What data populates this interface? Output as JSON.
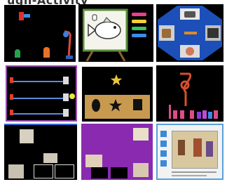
{
  "page": {
    "top_strip_text": "ugh-Activity"
  },
  "tiles": [
    {
      "id": "t1",
      "theme": "black-stage",
      "icons": [
        "toy-red",
        "ball-blue",
        "figure-green",
        "figure-orange",
        "toy-blue-lever"
      ]
    },
    {
      "id": "t2",
      "theme": "easel-board",
      "icons": [
        "fish-on-easel",
        "marker-pink",
        "marker-yellow",
        "marker-green",
        "marker-blue"
      ]
    },
    {
      "id": "t3",
      "theme": "octagon-carousel",
      "icons": [
        "camera",
        "cake",
        "pencil",
        "tool",
        "doll"
      ]
    },
    {
      "id": "t4",
      "theme": "race-lanes",
      "icons": [
        "runner",
        "bunny",
        "ball"
      ]
    },
    {
      "id": "t5",
      "theme": "shape-match",
      "icons": [
        "star-target",
        "circle",
        "star",
        "square"
      ]
    },
    {
      "id": "t6",
      "theme": "pipe-bars",
      "icons": [
        "red-pipe",
        "bar-graph"
      ]
    },
    {
      "id": "t7",
      "theme": "select-board",
      "icons": [
        "photo",
        "photo",
        "photo",
        "slot"
      ]
    },
    {
      "id": "t8",
      "theme": "purple-choice",
      "icons": [
        "photo",
        "photo",
        "photo",
        "photo",
        "slot",
        "slot"
      ]
    },
    {
      "id": "t9",
      "theme": "software-window",
      "icons": [
        "sidebar-button",
        "sidebar-button",
        "sidebar-button",
        "sidebar-button",
        "classroom-scene"
      ]
    }
  ]
}
